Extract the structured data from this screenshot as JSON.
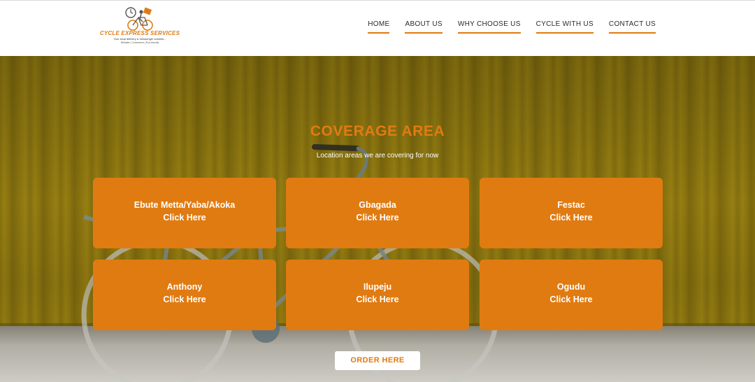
{
  "header": {
    "logo": {
      "brand": "CYCLE EXPRESS SERVICES",
      "tagline": "Your local delivery & messenger solution...",
      "subtag": "Reliable | Convenient | Eco-friendly"
    },
    "nav": [
      "HOME",
      "ABOUT US",
      "WHY CHOOSE US",
      "CYCLE WITH US",
      "CONTACT US"
    ]
  },
  "hero": {
    "title": "COVERAGE AREA",
    "subtitle": "Location areas we are covering for now",
    "cards": [
      {
        "name": "Ebute Metta/Yaba/Akoka",
        "link": "Click Here"
      },
      {
        "name": "Gbagada",
        "link": "Click Here"
      },
      {
        "name": "Festac",
        "link": "Click Here"
      },
      {
        "name": "Anthony",
        "link": "Click Here"
      },
      {
        "name": "Ilupeju",
        "link": "Click Here"
      },
      {
        "name": "Ogudu",
        "link": "Click Here"
      }
    ],
    "order_button": "ORDER HERE"
  },
  "colors": {
    "accent": "#e07b12",
    "background_wall": "#8f7810"
  }
}
